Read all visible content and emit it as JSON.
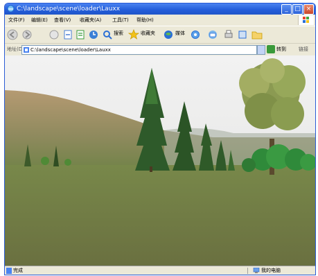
{
  "window": {
    "title": "C:\\landscape\\scene\\loader\\Lauxx",
    "minimize_label": "_",
    "maximize_label": "□",
    "close_label": "×"
  },
  "menu": {
    "items": [
      "文件(F)",
      "编辑(E)",
      "查看(V)",
      "收藏夹(A)",
      "工具(T)",
      "帮助(H)"
    ]
  },
  "toolbar": {
    "search_label": "搜索",
    "favorites_label": "收藏夹",
    "media_label": "媒体"
  },
  "addressbar": {
    "label": "地址(D)",
    "value": "C:\\landscape\\scene\\loader\\Lauxx",
    "go_label": "转到",
    "links_label": "链接"
  },
  "status": {
    "text": "完成",
    "zone": "我的电脑"
  },
  "colors": {
    "titlebar": "#245edb",
    "chrome": "#ece9d8",
    "sky": "#ebebeb",
    "ground": "#6e7a44"
  }
}
